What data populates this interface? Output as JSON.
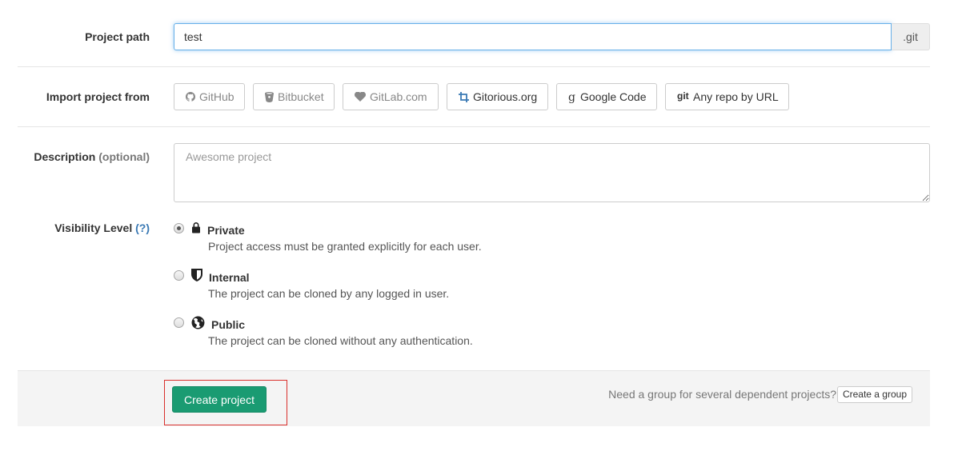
{
  "project_path": {
    "label": "Project path",
    "value": "test",
    "suffix": ".git"
  },
  "import": {
    "label": "Import project from",
    "sources": [
      {
        "label": "GitHub",
        "icon": "github-icon",
        "enabled": false
      },
      {
        "label": "Bitbucket",
        "icon": "bitbucket-icon",
        "enabled": false
      },
      {
        "label": "GitLab.com",
        "icon": "heart-icon",
        "enabled": false
      },
      {
        "label": "Gitorious.org",
        "icon": "gitorious-icon",
        "enabled": true
      },
      {
        "label": "Google Code",
        "icon": "google-icon",
        "enabled": true
      },
      {
        "label": "Any repo by URL",
        "icon": "git-icon",
        "enabled": true
      }
    ]
  },
  "description": {
    "label": "Description",
    "label_optional": "(optional)",
    "placeholder": "Awesome project",
    "value": ""
  },
  "visibility": {
    "label": "Visibility Level",
    "help": "(?)",
    "selected": "private",
    "options": [
      {
        "id": "private",
        "title": "Private",
        "icon": "lock-icon",
        "description": "Project access must be granted explicitly for each user."
      },
      {
        "id": "internal",
        "title": "Internal",
        "icon": "shield-icon",
        "description": "The project can be cloned by any logged in user."
      },
      {
        "id": "public",
        "title": "Public",
        "icon": "globe-icon",
        "description": "The project can be cloned without any authentication."
      }
    ]
  },
  "actions": {
    "create_label": "Create project",
    "create_color": "#1a9b72",
    "group_hint": "Need a group for several dependent projects?",
    "group_button": "Create a group",
    "highlight_color": "#d9302c"
  }
}
